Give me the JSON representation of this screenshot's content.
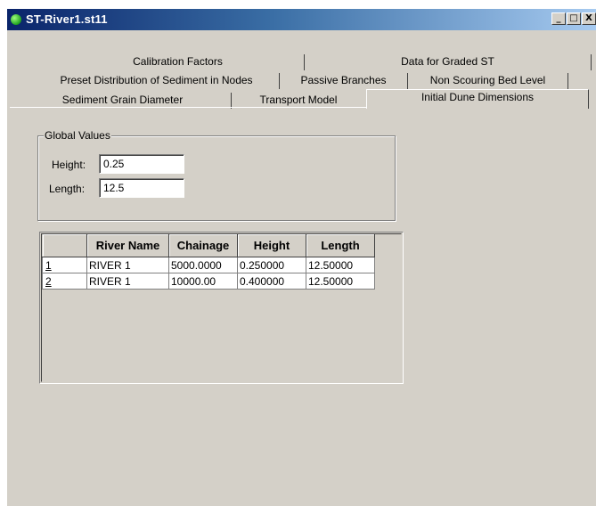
{
  "window": {
    "title": "ST-River1.st11",
    "controls": {
      "minimize": "_",
      "maximize": "□",
      "close": "X"
    }
  },
  "tabs": {
    "row1": [
      "Calibration Factors",
      "Data for Graded ST"
    ],
    "row2": [
      "Preset Distribution of Sediment in Nodes",
      "Passive Branches",
      "Non Scouring Bed Level"
    ],
    "row3": [
      "Sediment Grain Diameter",
      "Transport Model",
      "Initial Dune Dimensions"
    ],
    "active": "Initial Dune Dimensions"
  },
  "global_values": {
    "title": "Global Values",
    "height_label": "Height:",
    "height_value": "0.25",
    "length_label": "Length:",
    "length_value": "12.5"
  },
  "grid": {
    "columns": [
      "",
      "River Name",
      "Chainage",
      "Height",
      "Length"
    ],
    "rows": [
      {
        "num": "1",
        "river_name": "RIVER 1",
        "chainage": "5000.0000",
        "height": "0.250000",
        "length": "12.50000"
      },
      {
        "num": "2",
        "river_name": "RIVER 1",
        "chainage": "10000.00",
        "height": "0.400000",
        "length": "12.50000"
      }
    ]
  },
  "colors": {
    "face": "#d4d0c8",
    "title_start": "#0a246a",
    "title_end": "#a6caf0"
  }
}
